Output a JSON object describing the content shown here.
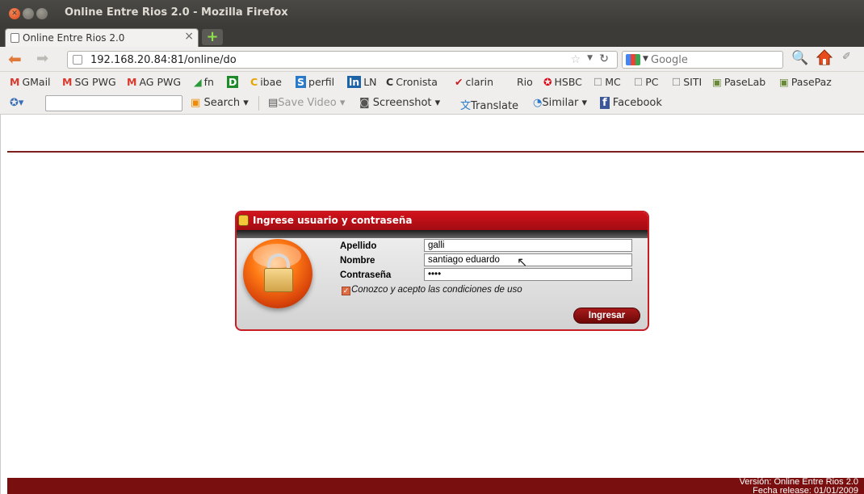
{
  "window": {
    "title": "Online Entre Rios 2.0 - Mozilla Firefox"
  },
  "tab": {
    "label": "Online Entre Rios 2.0"
  },
  "nav": {
    "url": "192.168.20.84:81/online/do",
    "search_placeholder": "Google"
  },
  "bookmarks": [
    {
      "icon": "gmail-icon",
      "label": "GMail"
    },
    {
      "icon": "gmail-icon",
      "label": "SG PWG"
    },
    {
      "icon": "gmail-icon",
      "label": "AG PWG"
    },
    {
      "icon": "chart-icon",
      "label": "fn"
    },
    {
      "icon": "d-icon",
      "label": ""
    },
    {
      "icon": "c-icon",
      "label": "ibae"
    },
    {
      "icon": "s-icon",
      "label": "perfil"
    },
    {
      "icon": "ln-icon",
      "label": "LN"
    },
    {
      "icon": "c-icon",
      "label": "Cronista"
    },
    {
      "icon": "check-icon",
      "label": "clarin"
    },
    {
      "icon": "blank-icon",
      "label": "Rio"
    },
    {
      "icon": "hsbc-icon",
      "label": "HSBC"
    },
    {
      "icon": "page-icon",
      "label": "MC"
    },
    {
      "icon": "page-icon",
      "label": "PC"
    },
    {
      "icon": "page-icon",
      "label": "SITI"
    },
    {
      "icon": "image-icon",
      "label": "PaseLab"
    },
    {
      "icon": "image-icon",
      "label": "PasePaz"
    }
  ],
  "toolbar2": {
    "search": "Search",
    "save_video": "Save Video",
    "screenshot": "Screenshot",
    "translate": "Translate",
    "similar": "Similar",
    "facebook": "Facebook"
  },
  "dialog": {
    "title": "Ingrese usuario y contraseña",
    "apellido_label": "Apellido",
    "apellido_value": "galli",
    "nombre_label": "Nombre",
    "nombre_value": "santiago eduardo",
    "contrasena_label": "Contraseña",
    "contrasena_value": "••••",
    "terms": "Conozco y acepto las condiciones de uso",
    "submit": "Ingresar"
  },
  "footer": {
    "line1": "Versión: Online Entre Rios 2.0",
    "line2": "Fecha release: 01/01/2009"
  },
  "colors": {
    "accent": "#c81d25",
    "footer": "#7a0f0f",
    "titlebar": "#3c3b37"
  }
}
